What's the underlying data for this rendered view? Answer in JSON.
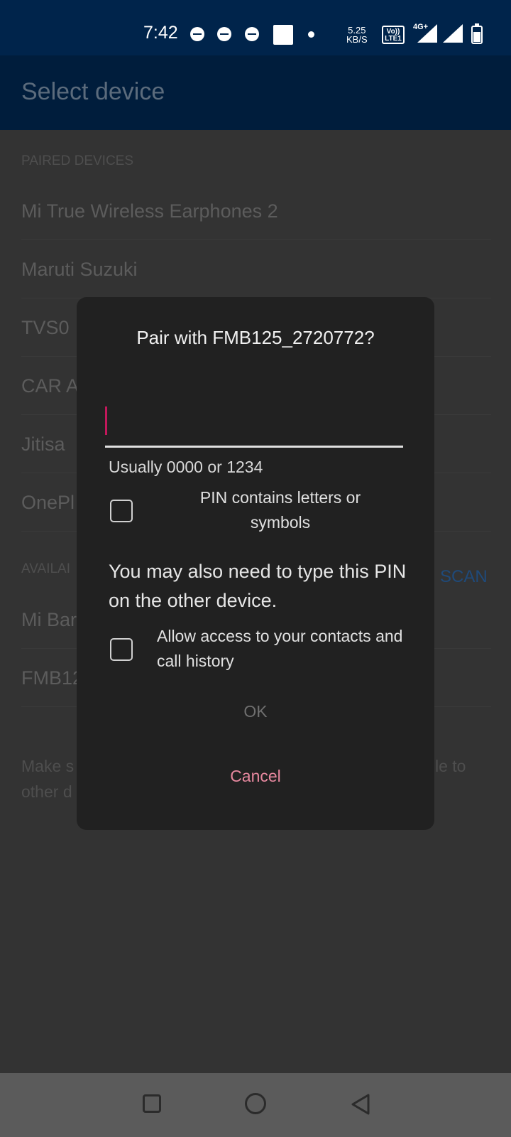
{
  "status_bar": {
    "time": "7:42",
    "net_speed_value": "5.25",
    "net_speed_unit": "KB/S",
    "volte_top": "Vo))",
    "volte_bottom": "LTE1",
    "network_type": "4G+",
    "icons": [
      "notification-icon",
      "notification-icon",
      "notification-icon",
      "square-icon",
      "dot-icon",
      "volte-icon",
      "signal-icon",
      "signal-icon",
      "battery-icon"
    ]
  },
  "app_bar": {
    "title": "Select device"
  },
  "paired": {
    "header": "PAIRED DEVICES",
    "items": [
      "Mi True Wireless Earphones 2",
      "Maruti Suzuki",
      "TVS0",
      "CAR A",
      "Jitisa",
      "OnePl"
    ]
  },
  "available": {
    "header": "AVAILAI",
    "scan_label": "SCAN",
    "items": [
      "Mi Bar",
      "FMB12"
    ]
  },
  "footer": {
    "line1_left": "Make s",
    "line1_right": "le to",
    "line2_left": "other d"
  },
  "dialog": {
    "title": "Pair with FMB125_2720772?",
    "pin_value": "",
    "hint": "Usually 0000 or 1234",
    "pin_letters_label": "PIN contains letters or symbols",
    "message": "You may also need to type this PIN on the other device.",
    "contacts_label": "Allow access to your contacts and call history",
    "ok_label": "OK",
    "cancel_label": "Cancel"
  },
  "nav_bar": {
    "icons": [
      "recent-apps-icon",
      "home-icon",
      "back-icon"
    ]
  },
  "colors": {
    "status_bar_bg": "#00244b",
    "app_bar_bg": "#001d3c",
    "dialog_bg": "#212121",
    "accent_pink": "#e7889f",
    "caret": "#c2185b"
  }
}
